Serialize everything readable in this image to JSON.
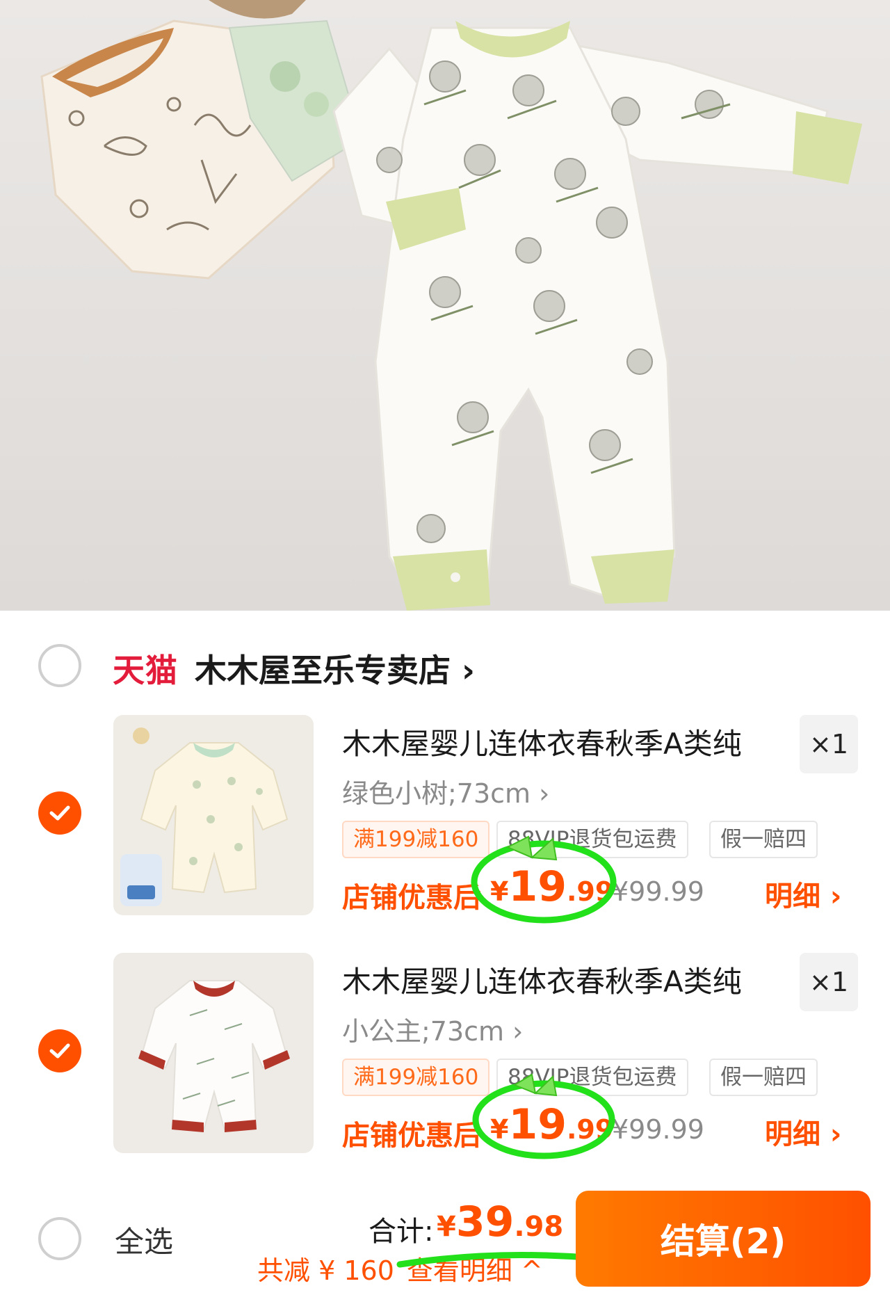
{
  "store": {
    "platform_badge": "天猫",
    "name": "木木屋至乐专卖店",
    "chevron": "›"
  },
  "items": [
    {
      "title": "木木屋婴儿连体衣春秋季A类纯",
      "sku": "绿色小树;73cm ›",
      "qty": "×1",
      "tags": [
        "满199减160",
        "88VIP退货包运费",
        "假一赔四"
      ],
      "after_label": "店铺优惠后",
      "price_currency": "¥",
      "price_int": "19",
      "price_dec": ".99",
      "orig_price": "¥99.99",
      "detail": "明细 ›",
      "checked": true
    },
    {
      "title": "木木屋婴儿连体衣春秋季A类纯",
      "sku": "小公主;73cm ›",
      "qty": "×1",
      "tags": [
        "满199减160",
        "88VIP退货包运费",
        "假一赔四"
      ],
      "after_label": "店铺优惠后",
      "price_currency": "¥",
      "price_int": "19",
      "price_dec": ".99",
      "orig_price": "¥99.99",
      "detail": "明细 ›",
      "checked": true
    }
  ],
  "footer": {
    "select_all": "全选",
    "total_label": "合计:",
    "total_currency": "¥",
    "total_int": "39",
    "total_dec": ".98",
    "discount_text": "共减 ¥ 160",
    "discount_detail": "查看明细 ^",
    "checkout_label": "结算(2)"
  },
  "colors": {
    "accent": "#ff5000",
    "tmall_red": "#e41c3b",
    "annotation_green": "#22e01a"
  }
}
